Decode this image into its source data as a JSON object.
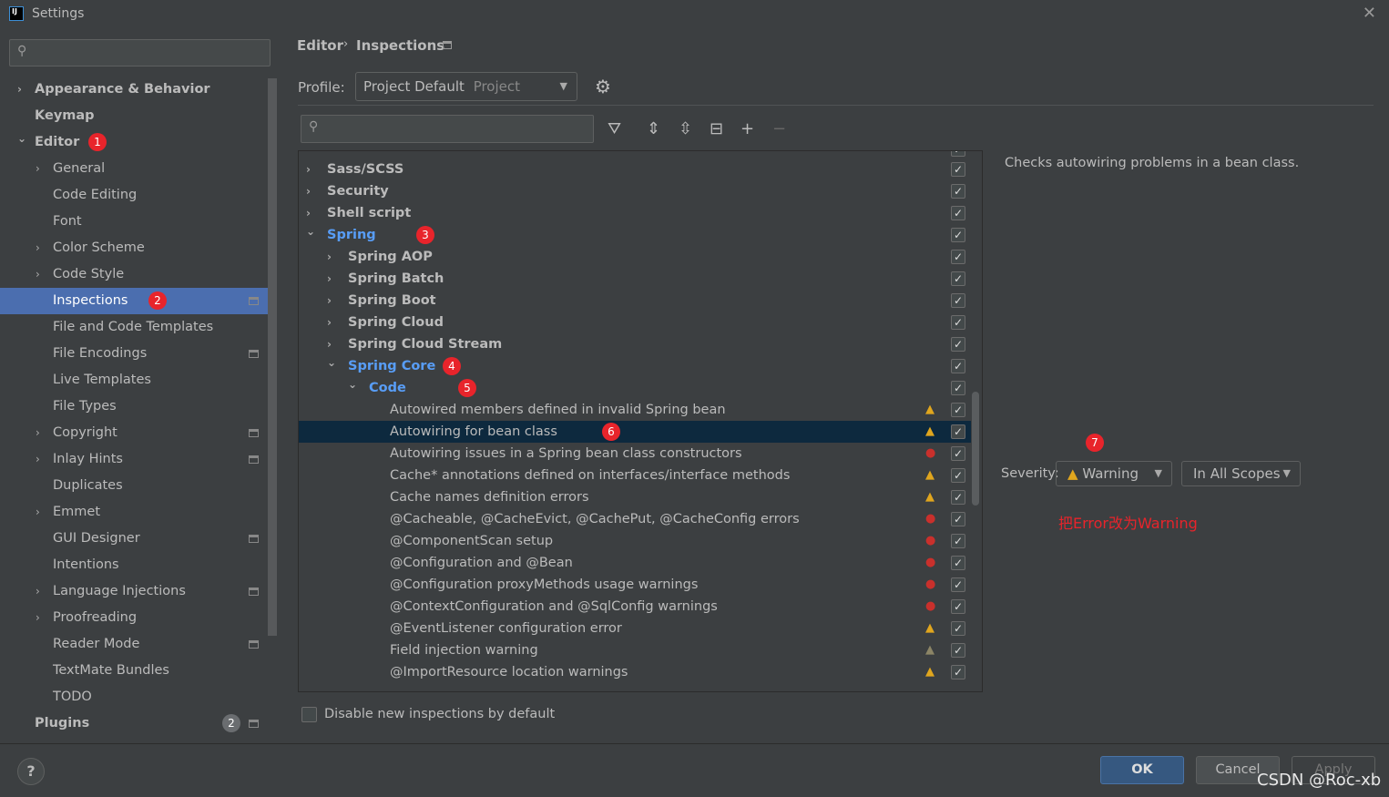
{
  "window": {
    "title": "Settings",
    "close": "✕"
  },
  "sidebar": {
    "items": [
      {
        "label": "Appearance & Behavior",
        "level": 0,
        "bold": true,
        "chevron": "right"
      },
      {
        "label": "Keymap",
        "level": 0,
        "bold": true
      },
      {
        "label": "Editor",
        "level": 0,
        "bold": true,
        "chevron": "down",
        "badge": "1"
      },
      {
        "label": "General",
        "level": 1,
        "chevron": "right"
      },
      {
        "label": "Code Editing",
        "level": 1
      },
      {
        "label": "Font",
        "level": 1
      },
      {
        "label": "Color Scheme",
        "level": 1,
        "chevron": "right"
      },
      {
        "label": "Code Style",
        "level": 1,
        "chevron": "right"
      },
      {
        "label": "Inspections",
        "level": 1,
        "selected": true,
        "badge": "2",
        "settings": true
      },
      {
        "label": "File and Code Templates",
        "level": 1
      },
      {
        "label": "File Encodings",
        "level": 1,
        "settings": true
      },
      {
        "label": "Live Templates",
        "level": 1
      },
      {
        "label": "File Types",
        "level": 1
      },
      {
        "label": "Copyright",
        "level": 1,
        "chevron": "right",
        "settings": true
      },
      {
        "label": "Inlay Hints",
        "level": 1,
        "chevron": "right",
        "settings": true
      },
      {
        "label": "Duplicates",
        "level": 1
      },
      {
        "label": "Emmet",
        "level": 1,
        "chevron": "right"
      },
      {
        "label": "GUI Designer",
        "level": 1,
        "settings": true
      },
      {
        "label": "Intentions",
        "level": 1
      },
      {
        "label": "Language Injections",
        "level": 1,
        "chevron": "right",
        "settings": true
      },
      {
        "label": "Proofreading",
        "level": 1,
        "chevron": "right"
      },
      {
        "label": "Reader Mode",
        "level": 1,
        "settings": true
      },
      {
        "label": "TextMate Bundles",
        "level": 1
      },
      {
        "label": "TODO",
        "level": 1
      },
      {
        "label": "Plugins",
        "level": 0,
        "bold": true,
        "count": "2",
        "settings": true
      }
    ]
  },
  "breadcrumb": {
    "parent": "Editor",
    "separator": "›",
    "current": "Inspections"
  },
  "profile": {
    "label": "Profile:",
    "value": "Project Default",
    "scope": "Project"
  },
  "toolbar": {
    "icons": [
      "filter-icon",
      "expand-all-icon",
      "collapse-all-icon",
      "reset-icon",
      "add-icon",
      "remove-icon"
    ]
  },
  "tree": {
    "rows": [
      {
        "label": "Sass/SCSS",
        "level": 0,
        "bold": true,
        "chevron": "right"
      },
      {
        "label": "Security",
        "level": 0,
        "bold": true,
        "chevron": "right"
      },
      {
        "label": "Shell script",
        "level": 0,
        "bold": true,
        "chevron": "right"
      },
      {
        "label": "Spring",
        "level": 0,
        "bold": true,
        "blue": true,
        "chevron": "down",
        "badge": "3"
      },
      {
        "label": "Spring AOP",
        "level": 1,
        "bold": true,
        "chevron": "right"
      },
      {
        "label": "Spring Batch",
        "level": 1,
        "bold": true,
        "chevron": "right"
      },
      {
        "label": "Spring Boot",
        "level": 1,
        "bold": true,
        "chevron": "right"
      },
      {
        "label": "Spring Cloud",
        "level": 1,
        "bold": true,
        "chevron": "right"
      },
      {
        "label": "Spring Cloud Stream",
        "level": 1,
        "bold": true,
        "chevron": "right"
      },
      {
        "label": "Spring Core",
        "level": 1,
        "bold": true,
        "blue": true,
        "chevron": "down",
        "badge": "4"
      },
      {
        "label": "Code",
        "level": 2,
        "bold": true,
        "blue": true,
        "chevron": "down",
        "badge": "5"
      },
      {
        "label": "Autowired members defined in invalid Spring bean",
        "level": 3,
        "severity": "warning"
      },
      {
        "label": "Autowiring for bean class",
        "level": 3,
        "severity": "warning",
        "selected": true,
        "badge": "6"
      },
      {
        "label": "Autowiring issues in a Spring bean class constructors",
        "level": 3,
        "severity": "error"
      },
      {
        "label": "Cache* annotations defined on interfaces/interface methods",
        "level": 3,
        "severity": "warning"
      },
      {
        "label": "Cache names definition errors",
        "level": 3,
        "severity": "warning"
      },
      {
        "label": "@Cacheable, @CacheEvict, @CachePut, @CacheConfig errors",
        "level": 3,
        "severity": "error"
      },
      {
        "label": "@ComponentScan setup",
        "level": 3,
        "severity": "error"
      },
      {
        "label": "@Configuration and @Bean",
        "level": 3,
        "severity": "error"
      },
      {
        "label": "@Configuration proxyMethods usage warnings",
        "level": 3,
        "severity": "error"
      },
      {
        "label": "@ContextConfiguration and @SqlConfig warnings",
        "level": 3,
        "severity": "error"
      },
      {
        "label": "@EventListener configuration error",
        "level": 3,
        "severity": "warning"
      },
      {
        "label": "Field injection warning",
        "level": 3,
        "severity": "weak"
      },
      {
        "label": "@ImportResource location warnings",
        "level": 3,
        "severity": "warning"
      }
    ]
  },
  "description": "Checks autowiring problems in a bean class.",
  "severity": {
    "label": "Severity:",
    "value": "Warning",
    "scope": "In All Scopes",
    "badge": "7"
  },
  "annotation": {
    "text": "把Error改为Warning",
    "color": "#e8242b"
  },
  "disable_new": {
    "label": "Disable new inspections by default",
    "checked": false
  },
  "buttons": {
    "ok": "OK",
    "cancel": "Cancel",
    "apply": "Apply",
    "help": "?"
  },
  "watermark": "CSDN @Roc-xb"
}
